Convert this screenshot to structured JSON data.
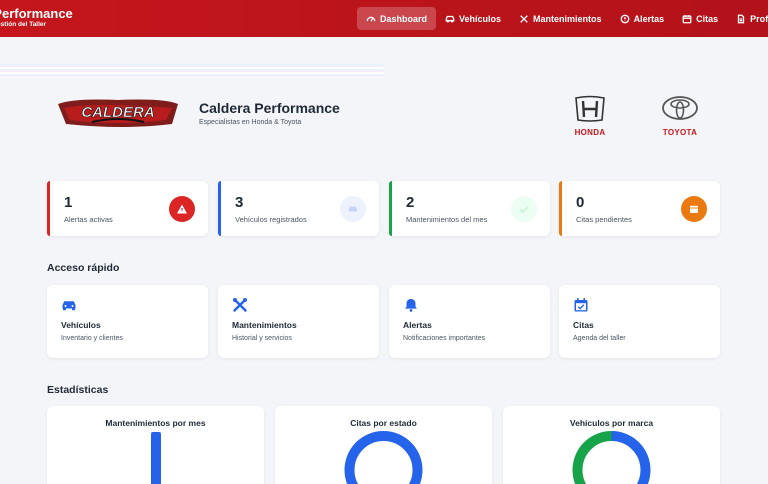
{
  "navbar": {
    "brand_title": "Caldera Performance",
    "brand_sub": "Gestión del Taller",
    "items": [
      {
        "label": "Dashboard",
        "icon": "gauge-icon",
        "active": true
      },
      {
        "label": "Vehículos",
        "icon": "car-icon",
        "active": false
      },
      {
        "label": "Mantenimientos",
        "icon": "tools-icon",
        "active": false
      },
      {
        "label": "Alertas",
        "icon": "alert-circle-icon",
        "active": false
      },
      {
        "label": "Citas",
        "icon": "calendar-icon",
        "active": false
      },
      {
        "label": "Proformas",
        "icon": "document-icon",
        "active": false
      }
    ]
  },
  "hero": {
    "logo_text": "CALDERA",
    "title": "Caldera Performance",
    "subtitle": "Especialistas en Honda & Toyota",
    "brands": [
      "HONDA",
      "TOYOTA"
    ]
  },
  "stats": [
    {
      "value": "1",
      "label": "Alertas activas",
      "icon": "warning-icon",
      "color": "#dc2626"
    },
    {
      "value": "3",
      "label": "Vehículos registrados",
      "icon": "car-icon",
      "color": "#2563eb"
    },
    {
      "value": "2",
      "label": "Mantenimientos del mes",
      "icon": "check-icon",
      "color": "#16a34a"
    },
    {
      "value": "0",
      "label": "Citas pendientes",
      "icon": "calendar-icon",
      "color": "#ea7a10"
    }
  ],
  "quick_access": {
    "title": "Acceso rápido",
    "items": [
      {
        "title": "Vehículos",
        "desc": "Inventario y clientes",
        "icon": "car-icon"
      },
      {
        "title": "Mantenimientos",
        "desc": "Historial y servicios",
        "icon": "tools-icon"
      },
      {
        "title": "Alertas",
        "desc": "Notificaciones importantes",
        "icon": "bell-icon"
      },
      {
        "title": "Citas",
        "desc": "Agenda del taller",
        "icon": "calendar-check-icon"
      }
    ]
  },
  "statistics": {
    "title": "Estadísticas",
    "charts": [
      {
        "title": "Mantenimientos por mes",
        "type": "bar"
      },
      {
        "title": "Citas por estado",
        "type": "doughnut"
      },
      {
        "title": "Vehículos por marca",
        "type": "doughnut"
      }
    ]
  },
  "colors": {
    "primary": "#c4161c",
    "blue": "#2563eb",
    "green": "#16a34a",
    "orange": "#ea7a10"
  }
}
